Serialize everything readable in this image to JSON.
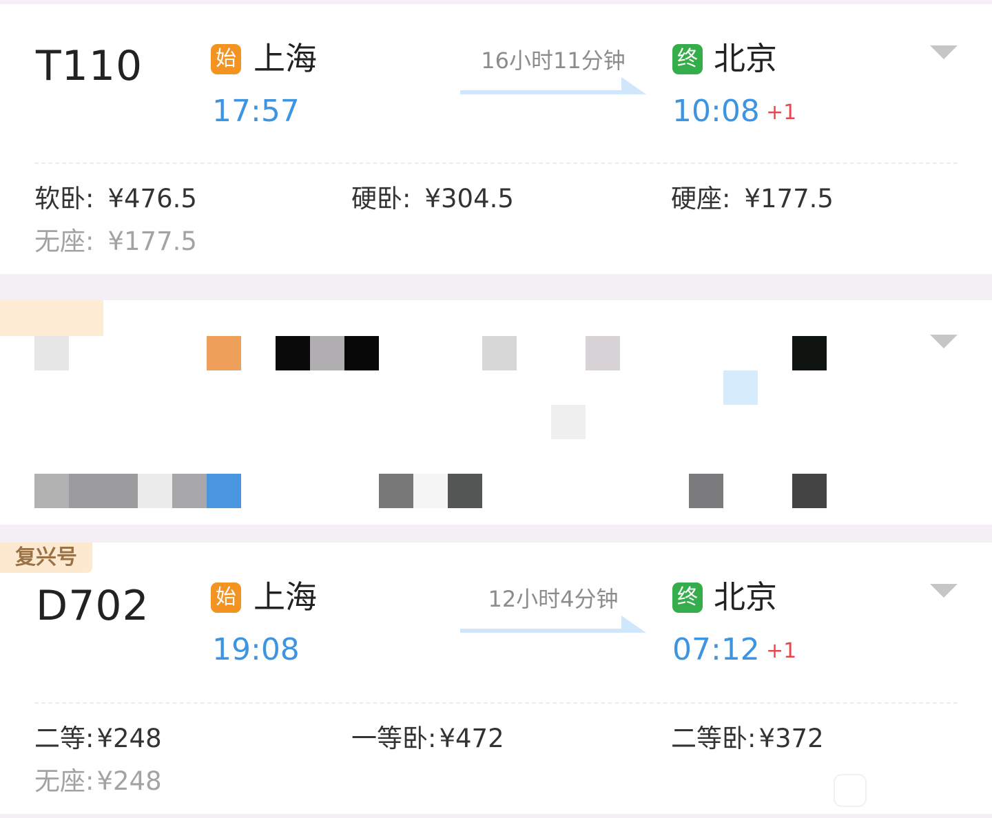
{
  "trains": [
    {
      "number": "T110",
      "badge_start": "始",
      "origin": "上海",
      "depart_time": "17:57",
      "duration": "16小时11分钟",
      "badge_end": "终",
      "destination": "北京",
      "arrive_time": "10:08",
      "day_offset": "+1",
      "seats": [
        {
          "name": "软卧:",
          "price": "¥476.5"
        },
        {
          "name": "硬卧:",
          "price": "¥304.5"
        },
        {
          "name": "硬座:",
          "price": "¥177.5"
        },
        {
          "name": "无座:",
          "price": "¥177.5"
        }
      ]
    },
    {
      "brand": "复兴号",
      "number": "D702",
      "badge_start": "始",
      "origin": "上海",
      "depart_time": "19:08",
      "duration": "12小时4分钟",
      "badge_end": "终",
      "destination": "北京",
      "arrive_time": "07:12",
      "day_offset": "+1",
      "seats": [
        {
          "name": "二等:",
          "price": "¥248"
        },
        {
          "name": "一等卧:",
          "price": "¥472"
        },
        {
          "name": "二等卧:",
          "price": "¥372"
        },
        {
          "name": "无座:",
          "price": "¥248"
        }
      ]
    }
  ],
  "icons": {
    "expand": "chevron-down-icon",
    "route_arrow": "arrow-right-icon"
  },
  "colors": {
    "time_blue": "#3d94e0",
    "start_badge": "#f39322",
    "end_badge": "#35ad4a",
    "day_offset_red": "#e5484d",
    "brand_tag_bg": "#fde9cf"
  }
}
